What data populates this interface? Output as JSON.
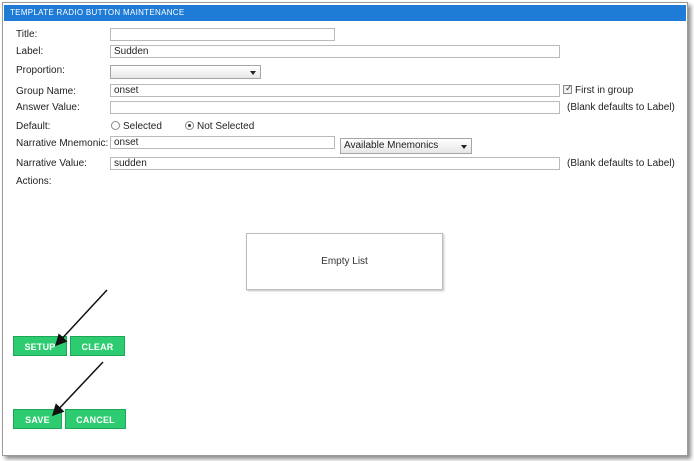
{
  "window": {
    "title": "TEMPLATE RADIO BUTTON MAINTENANCE"
  },
  "form": {
    "title": {
      "label": "Title:",
      "value": ""
    },
    "label": {
      "label": "Label:",
      "value": "Sudden"
    },
    "proportion": {
      "label": "Proportion:",
      "value": ""
    },
    "group_name": {
      "label": "Group Name:",
      "value": "onset",
      "first_in_group_label": "First in group",
      "first_in_group_checked": true
    },
    "answer_value": {
      "label": "Answer Value:",
      "value": "",
      "hint": "(Blank defaults to Label)"
    },
    "default": {
      "label": "Default:",
      "options": [
        "Selected",
        "Not Selected"
      ],
      "selected": "Not Selected"
    },
    "narrative_mnemonic": {
      "label": "Narrative Mnemonic:",
      "value": "onset",
      "dropdown_value": "Available Mnemonics"
    },
    "narrative_value": {
      "label": "Narrative Value:",
      "value": "sudden",
      "hint": "(Blank defaults to Label)"
    },
    "actions": {
      "label": "Actions:",
      "empty_text": "Empty List"
    }
  },
  "buttons": {
    "setup": "SETUP",
    "clear": "CLEAR",
    "save": "SAVE",
    "cancel": "CANCEL"
  },
  "colors": {
    "title_bar": "#1e7bd6",
    "button_green": "#2ecc71"
  }
}
